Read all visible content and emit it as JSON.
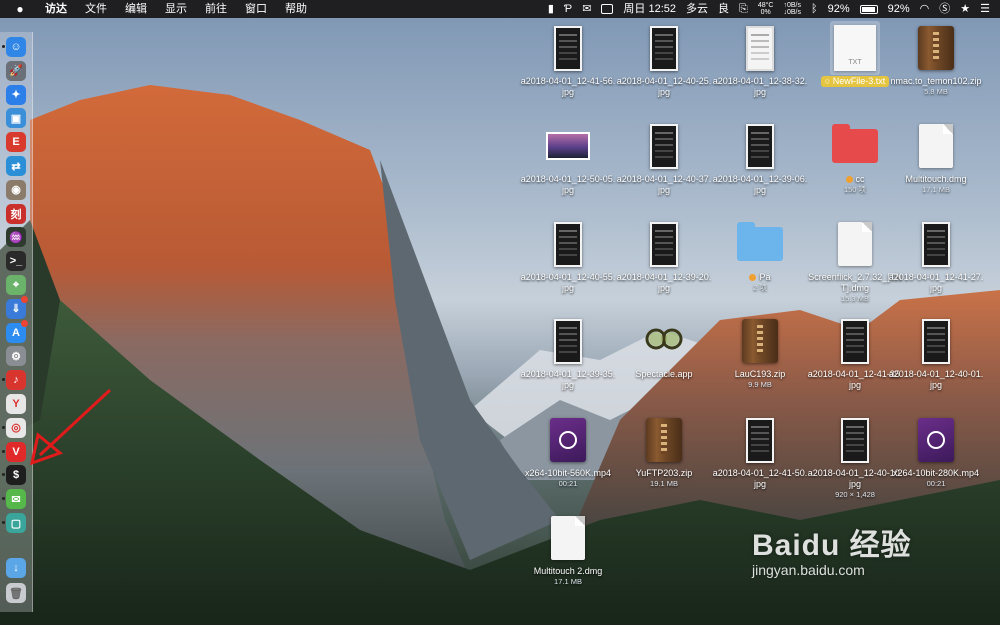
{
  "menubar": {
    "menus": [
      "访达",
      "文件",
      "编辑",
      "显示",
      "前往",
      "窗口",
      "帮助"
    ],
    "datetime": "周日 12:52",
    "weather": "多云",
    "air_quality": "良",
    "cpu_temp": "48°C",
    "cpu_load": "0%",
    "net_up": "↑0B/s",
    "net_down": "↓0B/s",
    "battery_a": "92%",
    "battery_b": "92%"
  },
  "dock": {
    "items": [
      {
        "name": "finder",
        "color": "#2f86e6",
        "glyph": "☺"
      },
      {
        "name": "launchpad",
        "color": "#6a6f78",
        "glyph": "🚀"
      },
      {
        "name": "safari",
        "color": "#2c7ee8",
        "glyph": "✦"
      },
      {
        "name": "preview",
        "color": "#3a8fd8",
        "glyph": "▣"
      },
      {
        "name": "app-red",
        "color": "#d83a2e",
        "glyph": "E"
      },
      {
        "name": "teamviewer",
        "color": "#2b8fd8",
        "glyph": "⇄"
      },
      {
        "name": "disk-utility",
        "color": "#8b7b6b",
        "glyph": "◉"
      },
      {
        "name": "app-red-2",
        "color": "#c9302c",
        "glyph": "刻"
      },
      {
        "name": "activity-monitor",
        "color": "#2d3a2d",
        "glyph": "♒"
      },
      {
        "name": "terminal",
        "color": "#2a2a2a",
        "glyph": ">_"
      },
      {
        "name": "maps",
        "color": "#6bb36b",
        "glyph": "⌖"
      },
      {
        "name": "app-blue-down",
        "color": "#3a7ad8",
        "glyph": "⇓"
      },
      {
        "name": "app-store",
        "color": "#2d8cf0",
        "glyph": "A"
      },
      {
        "name": "system-preferences",
        "color": "#8a8e94",
        "glyph": "⚙"
      },
      {
        "name": "netease-music",
        "color": "#d8352e",
        "glyph": "♪"
      },
      {
        "name": "yandex",
        "color": "#e6e6e6",
        "glyph": "Y"
      },
      {
        "name": "chrome",
        "color": "#e8e8e8",
        "glyph": "◎"
      },
      {
        "name": "vivaldi",
        "color": "#e02a2a",
        "glyph": "V"
      },
      {
        "name": "terminal-2",
        "color": "#1e1e1e",
        "glyph": "$"
      },
      {
        "name": "wechat",
        "color": "#56b84a",
        "glyph": "✉"
      },
      {
        "name": "app-teal",
        "color": "#3aa59a",
        "glyph": "▢"
      }
    ],
    "downloads": {
      "name": "downloads-folder",
      "color": "#5aa6e6",
      "glyph": "↓"
    },
    "trash": {
      "name": "trash",
      "color": "#c8ccd0",
      "glyph": "🗑"
    }
  },
  "desktop": {
    "items": [
      {
        "label": "a2018-04-01_12-41-56.jpg",
        "kind": "phone"
      },
      {
        "label": "a2018-04-01_12-40-25.jpg",
        "kind": "phone"
      },
      {
        "label": "a2018-04-01_12-38-32.jpg",
        "kind": "phone-light"
      },
      {
        "label": "NewFile-3.txt",
        "kind": "txt",
        "selected": true,
        "thumb_text": "TXT"
      },
      {
        "label": "nmac.to_temon102.zip",
        "kind": "zip",
        "sub": "5.8 MB"
      },
      {
        "label": "a2018-04-01_12-50-05.jpg",
        "kind": "photo"
      },
      {
        "label": "a2018-04-01_12-40-37.jpg",
        "kind": "phone"
      },
      {
        "label": "a2018-04-01_12-39-06.jpg",
        "kind": "phone"
      },
      {
        "label": "cc",
        "kind": "folder-red",
        "sub": "150 项",
        "tag": "#f0a030"
      },
      {
        "label": "Multitouch.dmg",
        "kind": "doc",
        "sub": "17.1 MB"
      },
      {
        "label": "a2018-04-01_12-40-55.jpg",
        "kind": "phone"
      },
      {
        "label": "a2018-04-01_12-39-20.jpg",
        "kind": "phone"
      },
      {
        "label": "Pa",
        "kind": "folder-blue",
        "sub": "2 项",
        "tag": "#f0a030"
      },
      {
        "label": "Screenflick_2.7.32_[TNT].dmg",
        "kind": "doc",
        "sub": "15.3 MB"
      },
      {
        "label": "a2018-04-01_12-41-27.jpg",
        "kind": "phone"
      },
      {
        "label": "a2018-04-01_12-39-35.jpg",
        "kind": "phone"
      },
      {
        "label": "Spectacle.app",
        "kind": "app-glasses"
      },
      {
        "label": "LauC193.zip",
        "kind": "zip",
        "sub": "9.9 MB"
      },
      {
        "label": "a2018-04-01_12-41-35.jpg",
        "kind": "phone"
      },
      {
        "label": "a2018-04-01_12-40-01.jpg",
        "kind": "phone"
      },
      {
        "label": "x264-10bit-560K.mp4",
        "kind": "video",
        "sub": "00:21"
      },
      {
        "label": "YuFTP203.zip",
        "kind": "zip",
        "sub": "19.1 MB"
      },
      {
        "label": "a2018-04-01_12-41-50.jpg",
        "kind": "phone"
      },
      {
        "label": "a2018-04-01_12-40-10.jpg",
        "kind": "phone",
        "sub": "920 × 1,428"
      },
      {
        "label": "x264-10bit-280K.mp4",
        "kind": "video",
        "sub": "00:21"
      },
      {
        "label": "Multitouch 2.dmg",
        "kind": "doc",
        "sub": "17.1 MB"
      }
    ]
  },
  "watermark": {
    "main": "Baidu 经验",
    "sub": "jingyan.baidu.com"
  },
  "colors": {
    "menubar": "#1f1f22",
    "arrow": "#e11b1b",
    "selection": "#e5c53f"
  }
}
